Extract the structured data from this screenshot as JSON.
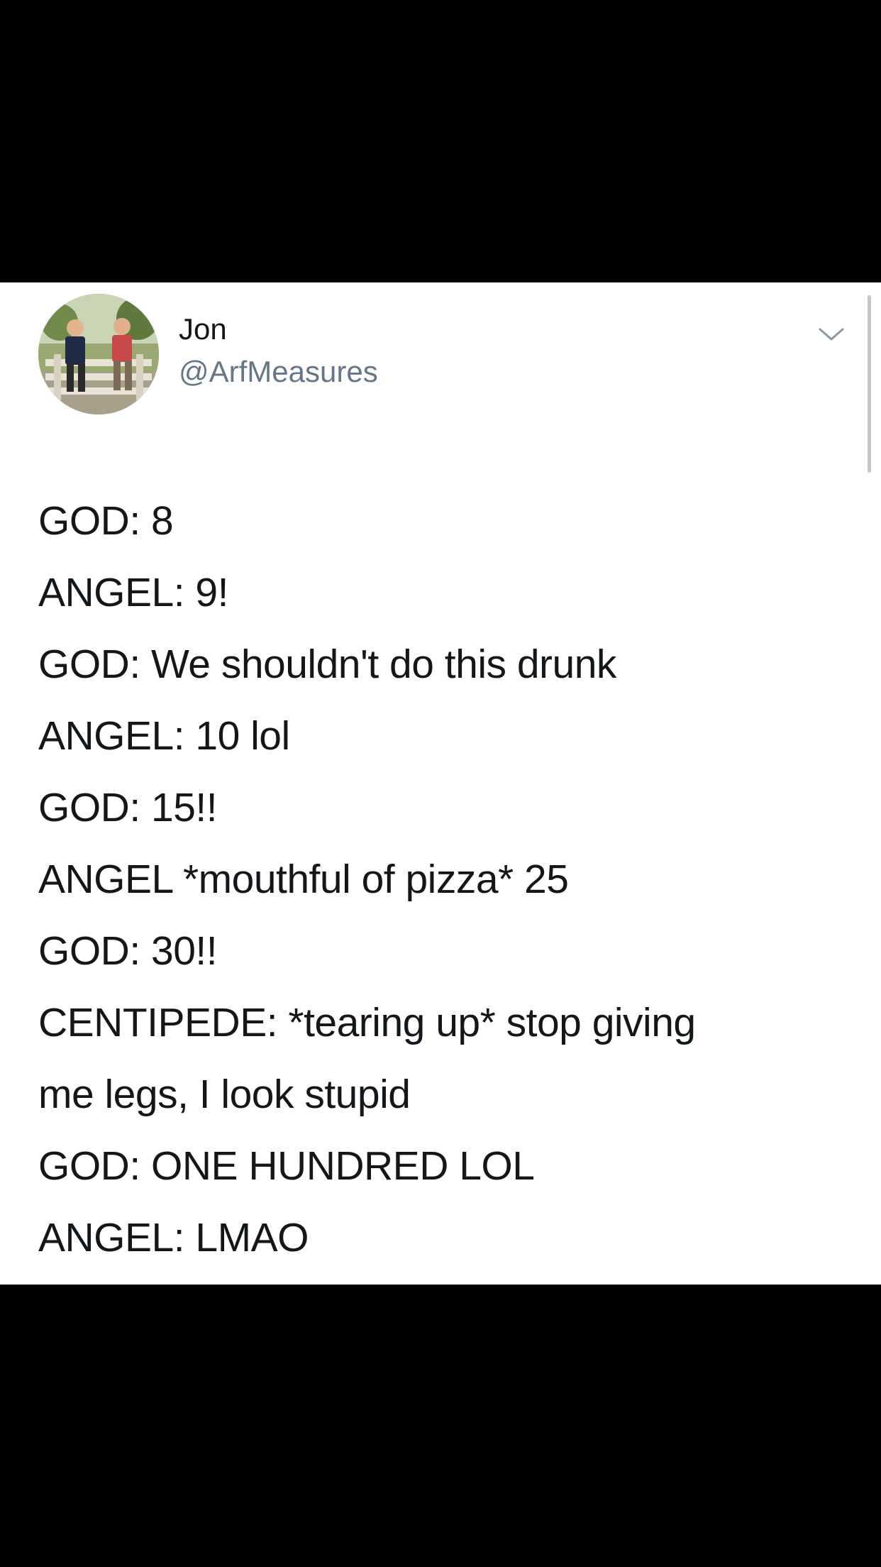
{
  "tweet": {
    "author": {
      "name": "Jon",
      "handle": "@ArfMeasures"
    },
    "lines": [
      "GOD: 8",
      "ANGEL: 9!",
      "GOD: We shouldn't do this drunk",
      "ANGEL: 10 lol",
      "GOD: 15!!",
      "ANGEL *mouthful of pizza* 25",
      "GOD: 30!!",
      "CENTIPEDE: *tearing up* stop giving",
      "me legs, I look stupid",
      "GOD: ONE HUNDRED LOL",
      "ANGEL: LMAO"
    ]
  },
  "icons": {
    "menu": "chevron-down-icon",
    "avatar": "profile-photo"
  },
  "colors": {
    "background": "#000000",
    "card": "#ffffff",
    "text": "#14171a",
    "handle": "#657786"
  }
}
